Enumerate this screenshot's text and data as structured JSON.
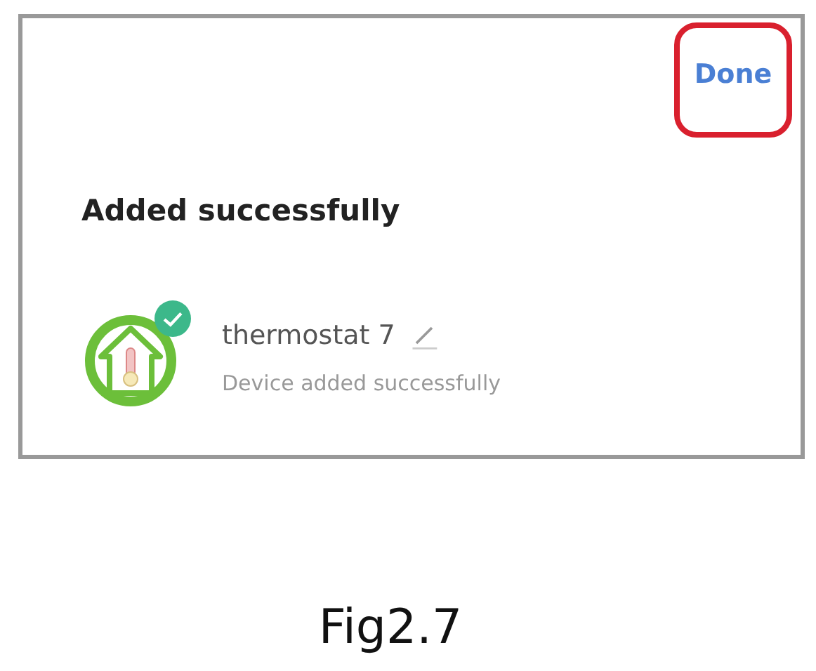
{
  "header": {
    "done_button": "Done"
  },
  "title": "Added successfully",
  "device": {
    "name": "thermostat 7",
    "status": "Device added successfully",
    "added": true
  },
  "caption": "Fig2.7"
}
